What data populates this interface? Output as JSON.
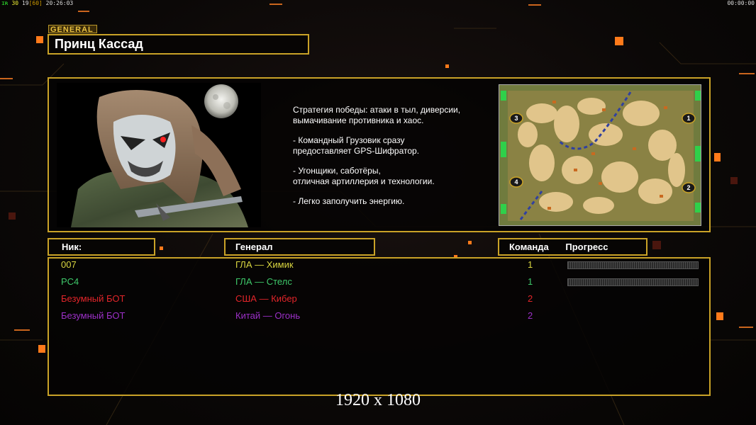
{
  "hud": {
    "fps_label": "ɪʀ",
    "stat1": "30",
    "stat2": "19",
    "stat3": "[60]",
    "clock": "20:26:03",
    "timer": "00:00:00"
  },
  "general": {
    "tag": "GENERAL",
    "name": "Принц Кассад"
  },
  "description": [
    "Стратегия победы: атаки в тыл, диверсии,\n вымачивание противника и хаос.",
    "- Командный Грузовик сразу\nпредоставляет GPS-Шифратор.",
    "- Угонщики, саботёры,\nотличная артиллерия и технологии.",
    "- Легко заполучить энергию."
  ],
  "map": {
    "slots": [
      "1",
      "2",
      "3",
      "4"
    ]
  },
  "headers": {
    "nick": "Ник:",
    "general": "Генерал",
    "team": "Команда",
    "progress": "Прогресс"
  },
  "players": [
    {
      "nick": "007",
      "general": "ГЛА — Химик",
      "team": "1",
      "color": "#d9d640",
      "progress": 0
    },
    {
      "nick": "PC4",
      "general": "ГЛА — Стелс",
      "team": "1",
      "color": "#3ec86a",
      "progress": 0
    },
    {
      "nick": "Безумный БОТ",
      "general": "США — Кибер",
      "team": "2",
      "color": "#e3252a",
      "progress": null
    },
    {
      "nick": "Безумный БОТ",
      "general": "Китай — Огонь",
      "team": "2",
      "color": "#9c30c8",
      "progress": null
    }
  ],
  "resolution": "1920 x 1080",
  "colors": {
    "frame": "#c9a227",
    "accent_orange": "#ff7a1a"
  }
}
